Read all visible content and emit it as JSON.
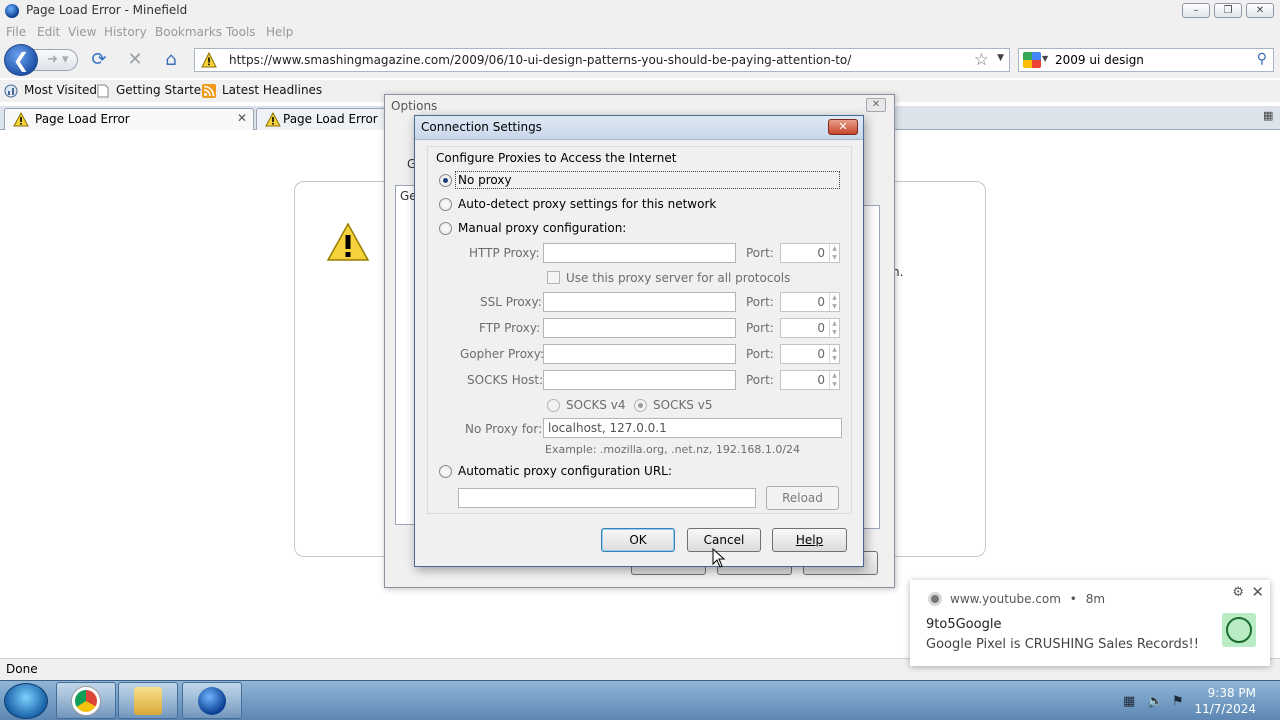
{
  "window": {
    "title": "Page Load Error - Minefield"
  },
  "menu": [
    "File",
    "Edit",
    "View",
    "History",
    "Bookmarks",
    "Tools",
    "Help"
  ],
  "navigation": {
    "url": "https://www.smashingmagazine.com/2009/06/10-ui-design-patterns-you-should-be-paying-attention-to/",
    "search_value": "2009 ui design"
  },
  "bookmarks": [
    "Most Visited",
    "Getting Started",
    "Latest Headlines"
  ],
  "tabs": [
    {
      "label": "Page Load Error"
    },
    {
      "label": "Page Load Error"
    }
  ],
  "page": {
    "fragment_a": "Ge",
    "fragment_b": "n."
  },
  "options_dialog": {
    "title": "Options",
    "tab_glimpse": "G"
  },
  "connection_settings": {
    "title": "Connection Settings",
    "group_label": "Configure Proxies to Access the Internet",
    "no_proxy": "No proxy",
    "auto_detect": "Auto-detect proxy settings for this network",
    "manual": "Manual proxy configuration:",
    "http_proxy": "HTTP Proxy:",
    "port_label": "Port:",
    "use_for_all": "Use this proxy server for all protocols",
    "ssl_proxy": "SSL Proxy:",
    "ftp_proxy": "FTP Proxy:",
    "gopher_proxy": "Gopher Proxy:",
    "socks_host": "SOCKS Host:",
    "socks_v4": "SOCKS v4",
    "socks_v5": "SOCKS v5",
    "no_proxy_for_label": "No Proxy for:",
    "no_proxy_for_value": "localhost, 127.0.0.1",
    "example": "Example: .mozilla.org, .net.nz, 192.168.1.0/24",
    "auto_url": "Automatic proxy configuration URL:",
    "ports": {
      "http": "0",
      "ssl": "0",
      "ftp": "0",
      "gopher": "0",
      "socks": "0"
    },
    "reload": "Reload",
    "ok": "OK",
    "cancel": "Cancel",
    "help": "Help",
    "selected_option": "No proxy"
  },
  "status": "Done",
  "notification": {
    "source": "www.youtube.com",
    "separator": "•",
    "age": "8m",
    "title": "9to5Google",
    "body": "Google Pixel is CRUSHING Sales Records!!"
  },
  "taskbar": {
    "time": "9:38 PM",
    "date": "11/7/2024"
  },
  "colors": {
    "accent": "#1e3c78",
    "taskbar": "#6d97c2",
    "close_red": "#c6442a"
  }
}
